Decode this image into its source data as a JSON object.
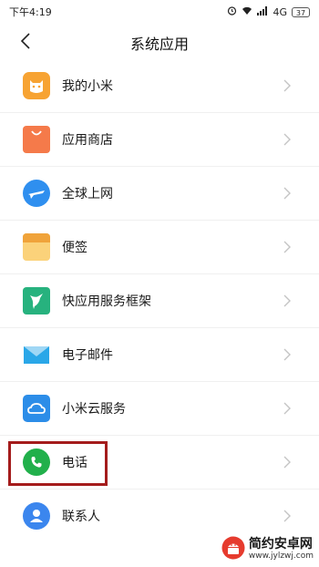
{
  "status": {
    "time": "下午4:19",
    "network": "4G",
    "battery": "37",
    "icons": [
      "alarm-icon",
      "wifi-icon",
      "signal-icon",
      "battery-icon"
    ]
  },
  "header": {
    "title": "系统应用",
    "back_icon": "back-arrow-icon"
  },
  "apps": [
    {
      "label": "我的小米",
      "icon": "mi-mascot-icon",
      "color": "#f7a333"
    },
    {
      "label": "应用商店",
      "icon": "shopping-bag-icon",
      "color": "#f57a4a"
    },
    {
      "label": "全球上网",
      "icon": "airplane-icon",
      "color": "#2f8fef"
    },
    {
      "label": "便签",
      "icon": "notepad-icon",
      "color": "#f6b74a"
    },
    {
      "label": "快应用服务框架",
      "icon": "hummingbird-icon",
      "color": "#27b27e"
    },
    {
      "label": "电子邮件",
      "icon": "mail-icon",
      "color": "#2aa7e8"
    },
    {
      "label": "小米云服务",
      "icon": "cloud-icon",
      "color": "#2c8de8"
    },
    {
      "label": "电话",
      "icon": "phone-icon",
      "color": "#21b04b"
    },
    {
      "label": "联系人",
      "icon": "contact-icon",
      "color": "#3b86ee"
    }
  ],
  "highlight": {
    "color": "#a41c1c",
    "target": "电话"
  },
  "watermark": {
    "name": "简约安卓网",
    "url": "www.jylzwj.com"
  }
}
